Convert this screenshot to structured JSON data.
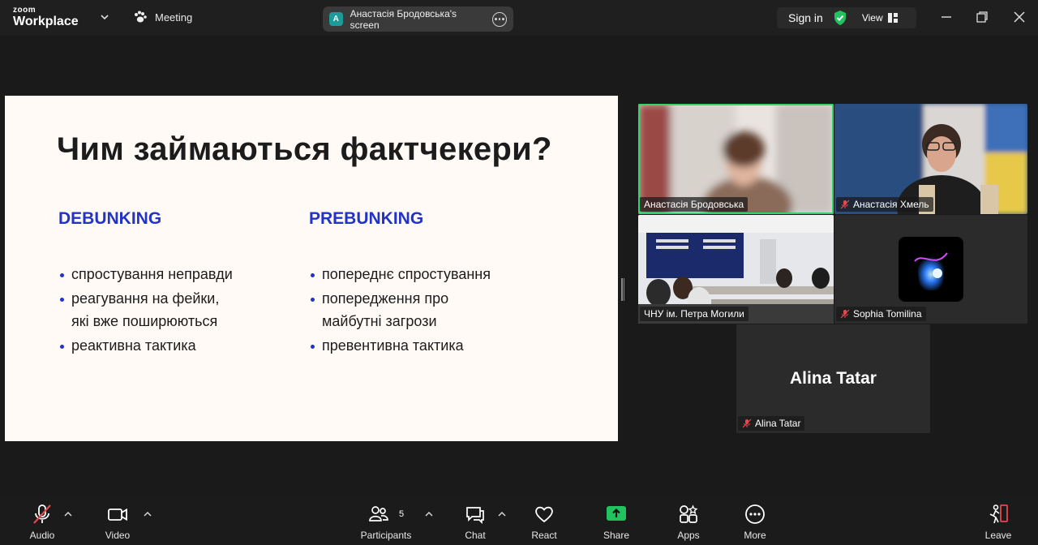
{
  "app": {
    "brand_small": "zoom",
    "brand_main": "Workplace"
  },
  "header": {
    "meeting_label": "Meeting",
    "screen_share": {
      "avatar_letter": "A",
      "label": "Анастасія Бродовська's screen"
    },
    "sign_in_label": "Sign in",
    "view_label": "View"
  },
  "slide": {
    "title": "Чим займаються фактчекери?",
    "left": {
      "heading": "DEBUNKING",
      "bullets": [
        "спростування неправди",
        "реагування на фейки,",
        "які вже поширюються",
        "реактивна тактика"
      ]
    },
    "right": {
      "heading": "PREBUNKING",
      "bullets": [
        "попереднє спростування",
        "попередження про",
        "майбутні загрози",
        "превентивна тактика"
      ]
    }
  },
  "participants": {
    "tiles": [
      {
        "name": "Анастасія Бродовська",
        "muted": false,
        "active": true
      },
      {
        "name": "Анастасія Хмель",
        "muted": true
      },
      {
        "name": "ЧНУ ім. Петра Могили",
        "muted": false
      },
      {
        "name": "Sophia Tomilina",
        "muted": true
      },
      {
        "name": "Alina Tatar",
        "display_name": "Alina Tatar",
        "muted": true
      }
    ]
  },
  "toolbar": {
    "audio": "Audio",
    "video": "Video",
    "participants": "Participants",
    "participants_count": "5",
    "chat": "Chat",
    "react": "React",
    "share": "Share",
    "apps": "Apps",
    "more": "More",
    "leave": "Leave"
  },
  "colors": {
    "accent_green": "#35d36b",
    "share_green": "#22c35e",
    "slide_heading_blue": "#2233c8",
    "mute_red": "#e5484d"
  },
  "icons": [
    "chevron-down-icon",
    "paw-icon",
    "more-icon",
    "shield-check-icon",
    "grid-view-icon",
    "minimize-icon",
    "restore-icon",
    "close-icon",
    "mic-off-icon",
    "video-icon",
    "participants-icon",
    "chat-icon",
    "heart-icon",
    "share-icon",
    "apps-icon",
    "more-circle-icon",
    "leave-icon"
  ]
}
